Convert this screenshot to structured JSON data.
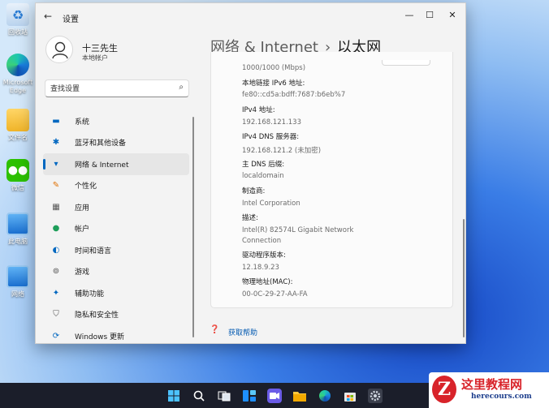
{
  "desktop": {
    "icons": [
      {
        "label": "回收站",
        "icon": "recycle-bin-icon"
      },
      {
        "label": "Microsoft\nEdge",
        "icon": "edge-icon"
      },
      {
        "label": "文件名",
        "icon": "folder-icon"
      },
      {
        "label": "微信",
        "icon": "wechat-icon"
      },
      {
        "label": "此电脑",
        "icon": "computer-icon"
      },
      {
        "label": "网络",
        "icon": "network-icon"
      }
    ]
  },
  "window": {
    "title": "设置",
    "back": "←",
    "minimize": "—",
    "maximize": "☐",
    "close": "✕"
  },
  "user": {
    "name": "十三先生",
    "account": "本地帐户"
  },
  "search": {
    "placeholder": "查找设置",
    "icon": "⌕"
  },
  "nav": {
    "items": [
      {
        "label": "系统",
        "icon": "system-icon",
        "color": "#0067c0",
        "active": false
      },
      {
        "label": "蓝牙和其他设备",
        "icon": "bluetooth-icon",
        "color": "#0067c0",
        "active": false
      },
      {
        "label": "网络 & Internet",
        "icon": "wifi-icon",
        "color": "#0067c0",
        "active": true
      },
      {
        "label": "个性化",
        "icon": "brush-icon",
        "color": "#e07000",
        "active": false
      },
      {
        "label": "应用",
        "icon": "apps-icon",
        "color": "#555555",
        "active": false
      },
      {
        "label": "帐户",
        "icon": "account-icon",
        "color": "#1e9e5a",
        "active": false
      },
      {
        "label": "时间和语言",
        "icon": "globe-clock-icon",
        "color": "#0067c0",
        "active": false
      },
      {
        "label": "游戏",
        "icon": "gamepad-icon",
        "color": "#555555",
        "active": false
      },
      {
        "label": "辅助功能",
        "icon": "accessibility-icon",
        "color": "#0067c0",
        "active": false
      },
      {
        "label": "隐私和安全性",
        "icon": "shield-icon",
        "color": "#555555",
        "active": false
      },
      {
        "label": "Windows 更新",
        "icon": "update-icon",
        "color": "#0067c0",
        "active": false
      }
    ]
  },
  "breadcrumb": {
    "parent": "网络 & Internet",
    "separator": "›",
    "current": "以太网"
  },
  "properties": {
    "link_speed_value": "1000/1000 (Mbps)",
    "ipv6_label": "本地链接 IPv6 地址:",
    "ipv6_value": "fe80::cd5a:bdff:7687:b6eb%7",
    "ipv4_label": "IPv4 地址:",
    "ipv4_value": "192.168.121.133",
    "dns_label": "IPv4 DNS 服务器:",
    "dns_value": "192.168.121.2 (未加密)",
    "suffix_label": "主 DNS 后缀:",
    "suffix_value": "localdomain",
    "maker_label": "制造商:",
    "maker_value": "Intel Corporation",
    "desc_label": "描述:",
    "desc_value_1": "Intel(R) 82574L Gigabit Network",
    "desc_value_2": "Connection",
    "driver_label": "驱动程序版本:",
    "driver_value": "12.18.9.23",
    "mac_label": "物理地址(MAC):",
    "mac_value": "00-0C-29-27-AA-FA"
  },
  "help": {
    "label": "获取帮助"
  },
  "taskbar": {
    "items": [
      "start-icon",
      "search-icon",
      "task-view-icon",
      "widgets-icon",
      "chat-icon",
      "file-explorer-icon",
      "edge-icon",
      "store-icon",
      "settings-icon"
    ]
  },
  "watermark": {
    "logo": "Z",
    "title": "这里教程网",
    "url": "herecours.com"
  }
}
